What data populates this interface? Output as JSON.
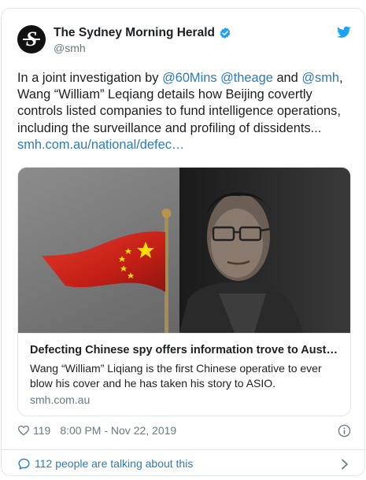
{
  "account": {
    "name": "The Sydney Morning Herald",
    "handle": "@smh",
    "avatar_letter": "S"
  },
  "tweet": {
    "text_parts": [
      {
        "text": "In a joint investigation by ",
        "link": false
      },
      {
        "text": "@60Mins",
        "link": true
      },
      {
        "text": " ",
        "link": false
      },
      {
        "text": "@theage",
        "link": true
      },
      {
        "text": " and ",
        "link": false
      },
      {
        "text": "@smh",
        "link": true
      },
      {
        "text": ", Wang “William” Leqiang details how Beijing covertly controls listed companies to fund intelligence operations, including the surveillance and profiling of dissidents... ",
        "link": false
      },
      {
        "text": "smh.com.au/national/defec…",
        "link": true
      }
    ]
  },
  "card": {
    "title": "Defecting Chinese spy offers information trove to Austra…",
    "description": "Wang “William” Liqiang is the first Chinese operative to ever blow his cover and he has taken his story to ASIO.",
    "domain": "smh.com.au"
  },
  "meta": {
    "likes": "119",
    "timestamp": "8:00 PM - Nov 22, 2019"
  },
  "footer": {
    "talking": "112 people are talking about this"
  },
  "colors": {
    "link": "#2b7bb9",
    "muted": "#697882",
    "twitter_blue": "#1da1f2",
    "flag_red": "#d8261d",
    "flag_star": "#ffde00"
  },
  "icons": [
    "verified-icon",
    "twitter-bird-icon",
    "heart-icon",
    "info-icon",
    "speech-bubble-icon",
    "chevron-right-icon"
  ]
}
